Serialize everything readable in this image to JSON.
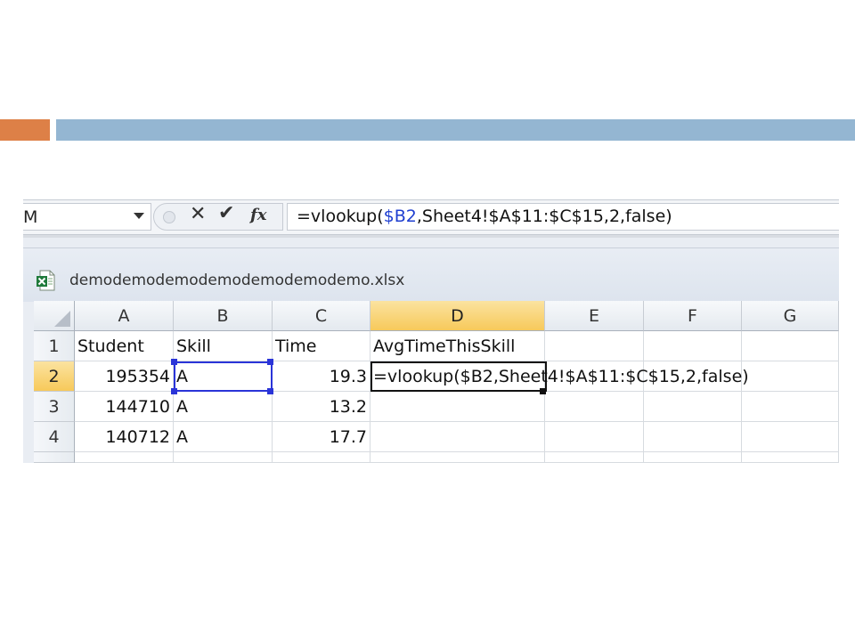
{
  "formula_bar": {
    "name_box": "M",
    "cancel_glyph": "✕",
    "enter_glyph": "✔",
    "fx_label": "fx",
    "formula_prefix": "=vlookup(",
    "formula_ref": "$B2",
    "formula_suffix": ",Sheet4!$A$11:$C$15,2,false)"
  },
  "workbook": {
    "filename": "demodemodemodemodemodemodemo.xlsx",
    "file_icon": "excel-file-icon"
  },
  "grid": {
    "columns": [
      "A",
      "B",
      "C",
      "D",
      "E",
      "F",
      "G"
    ],
    "rows": [
      "1",
      "2",
      "3",
      "4"
    ],
    "headers": [
      "Student",
      "Skill",
      "Time",
      "AvgTimeThisSkill"
    ],
    "data": [
      [
        "195354",
        "A",
        "19.3"
      ],
      [
        "144710",
        "A",
        "13.2"
      ],
      [
        "140712",
        "A",
        "17.7"
      ]
    ],
    "active_cell_text": "=vlookup($B2,Sheet4!$A$11:$C$15,2,false)",
    "selected_column": "D",
    "selected_row": "2"
  },
  "colors": {
    "accent_orange": "#dd8047",
    "accent_blue": "#94b6d2",
    "reference_blue": "#1f3fd0",
    "selection_gold": "#f7c95a"
  }
}
